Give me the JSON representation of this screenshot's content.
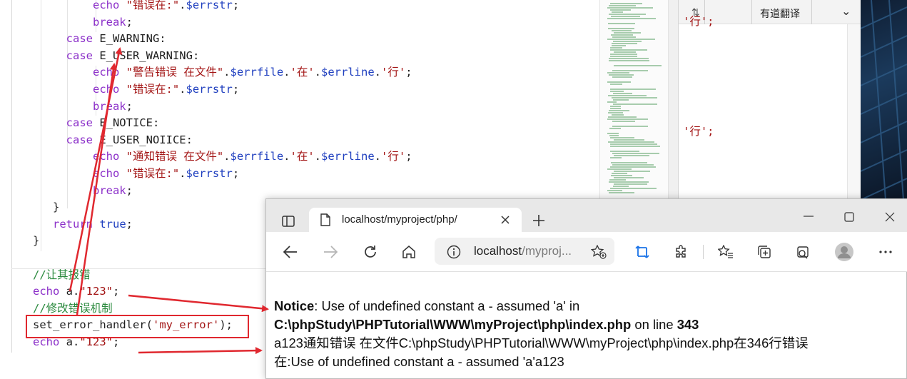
{
  "editor": {
    "lines": [
      {
        "indent": "            ",
        "parts": [
          [
            "kw",
            "echo"
          ],
          [
            "t",
            " "
          ],
          [
            "str",
            "\"错误在:\""
          ],
          [
            "t",
            "."
          ],
          [
            "var",
            "$errstr"
          ],
          [
            "t",
            ";"
          ]
        ]
      },
      {
        "indent": "            ",
        "parts": [
          [
            "kw",
            "break"
          ],
          [
            "t",
            ";"
          ]
        ]
      },
      {
        "indent": "        ",
        "parts": [
          [
            "kw",
            "case"
          ],
          [
            "t",
            " E_WARNING:"
          ]
        ]
      },
      {
        "indent": "        ",
        "parts": [
          [
            "kw",
            "case"
          ],
          [
            "t",
            " E_USER_WARNING:"
          ]
        ]
      },
      {
        "indent": "            ",
        "parts": [
          [
            "kw",
            "echo"
          ],
          [
            "t",
            " "
          ],
          [
            "str",
            "\"警告错误 在文件\""
          ],
          [
            "t",
            "."
          ],
          [
            "var",
            "$errfile"
          ],
          [
            "t",
            "."
          ],
          [
            "str",
            "'在'"
          ],
          [
            "t",
            "."
          ],
          [
            "var",
            "$errline"
          ],
          [
            "t",
            "."
          ],
          [
            "str",
            "'行'"
          ],
          [
            "t",
            ";"
          ]
        ]
      },
      {
        "indent": "            ",
        "parts": [
          [
            "kw",
            "echo"
          ],
          [
            "t",
            " "
          ],
          [
            "str",
            "\"错误在:\""
          ],
          [
            "t",
            "."
          ],
          [
            "var",
            "$errstr"
          ],
          [
            "t",
            ";"
          ]
        ]
      },
      {
        "indent": "            ",
        "parts": [
          [
            "kw",
            "break"
          ],
          [
            "t",
            ";"
          ]
        ]
      },
      {
        "indent": "        ",
        "parts": [
          [
            "kw",
            "case"
          ],
          [
            "t",
            " E_NOTICE:"
          ]
        ]
      },
      {
        "indent": "        ",
        "parts": [
          [
            "kw",
            "case"
          ],
          [
            "t",
            " E_USER_NOIICE:"
          ]
        ]
      },
      {
        "indent": "            ",
        "parts": [
          [
            "kw",
            "echo"
          ],
          [
            "t",
            " "
          ],
          [
            "str",
            "\"通知错误 在文件\""
          ],
          [
            "t",
            "."
          ],
          [
            "var",
            "$errfile"
          ],
          [
            "t",
            "."
          ],
          [
            "str",
            "'在'"
          ],
          [
            "t",
            "."
          ],
          [
            "var",
            "$errline"
          ],
          [
            "t",
            "."
          ],
          [
            "str",
            "'行'"
          ],
          [
            "t",
            ";"
          ]
        ]
      },
      {
        "indent": "            ",
        "parts": [
          [
            "kw",
            "echo"
          ],
          [
            "t",
            " "
          ],
          [
            "str",
            "\"错误在:\""
          ],
          [
            "t",
            "."
          ],
          [
            "var",
            "$errstr"
          ],
          [
            "t",
            ";"
          ]
        ]
      },
      {
        "indent": "            ",
        "parts": [
          [
            "kw",
            "break"
          ],
          [
            "t",
            ";"
          ]
        ]
      },
      {
        "indent": "      ",
        "parts": [
          [
            "t",
            "}"
          ]
        ]
      },
      {
        "indent": "      ",
        "parts": [
          [
            "kw",
            "return"
          ],
          [
            "t",
            " "
          ],
          [
            "kwb",
            "true"
          ],
          [
            "t",
            ";"
          ]
        ]
      },
      {
        "indent": "   ",
        "parts": [
          [
            "t",
            "}"
          ]
        ]
      },
      {
        "indent": "",
        "parts": [
          [
            "t",
            ""
          ]
        ]
      },
      {
        "indent": "   ",
        "parts": [
          [
            "cmt",
            "//让其报错"
          ]
        ]
      },
      {
        "indent": "   ",
        "parts": [
          [
            "kw",
            "echo"
          ],
          [
            "t",
            " a."
          ],
          [
            "str",
            "\"123\""
          ],
          [
            "t",
            ";"
          ]
        ]
      },
      {
        "indent": "   ",
        "parts": [
          [
            "cmt",
            "//修改错误机制"
          ]
        ]
      },
      {
        "indent": "   ",
        "parts": [
          [
            "t",
            "set_error_handler("
          ],
          [
            "str",
            "'my_error'"
          ],
          [
            "t",
            ");"
          ]
        ]
      },
      {
        "indent": "   ",
        "parts": [
          [
            "kw",
            "echo"
          ],
          [
            "t",
            " a."
          ],
          [
            "str",
            "\"123\""
          ],
          [
            "t",
            ";"
          ]
        ]
      }
    ]
  },
  "right_window": {
    "button_label": "有道翻译",
    "code_snippet_1": "'行';",
    "code_snippet_2": "'行';"
  },
  "browser": {
    "tab_title": "localhost/myproject/php/",
    "address_host": "localhost",
    "address_path": "/myproj...",
    "icons": {
      "sidebar": "sidebar-icon",
      "page": "page-icon",
      "close_tab": "close-icon",
      "new_tab": "plus-icon",
      "minimize": "minimize-icon",
      "maximize": "maximize-icon",
      "close_window": "close-icon",
      "back": "back-arrow-icon",
      "forward": "forward-arrow-icon",
      "refresh": "refresh-icon",
      "home": "home-icon",
      "info": "info-icon",
      "add_favorite": "add-favorite-icon",
      "translate": "translate-icon",
      "extensions": "extensions-icon",
      "favorites": "favorites-icon",
      "collections": "collections-icon",
      "screenshot": "web-capture-icon",
      "profile": "profile-icon",
      "more": "more-icon"
    },
    "output": {
      "notice_label": "Notice",
      "notice_msg": ": Use of undefined constant a - assumed 'a' in",
      "file_path": "C:\\phpStudy\\PHPTutorial\\WWW\\myProject\\php\\index.php",
      "on_line": " on line ",
      "line_number": "343",
      "line3": "a123通知错误 在文件C:\\phpStudy\\PHPTutorial\\WWW\\myProject\\php\\index.php在346行错误",
      "line4": "在:Use of undefined constant a - assumed 'a'a123"
    }
  },
  "colors": {
    "annotation": "#e0282f",
    "keyword": "#8b2fc9",
    "string": "#a31515",
    "variable": "#1f3fbf",
    "comment": "#2b8a3e",
    "accent": "#1a73e8"
  }
}
